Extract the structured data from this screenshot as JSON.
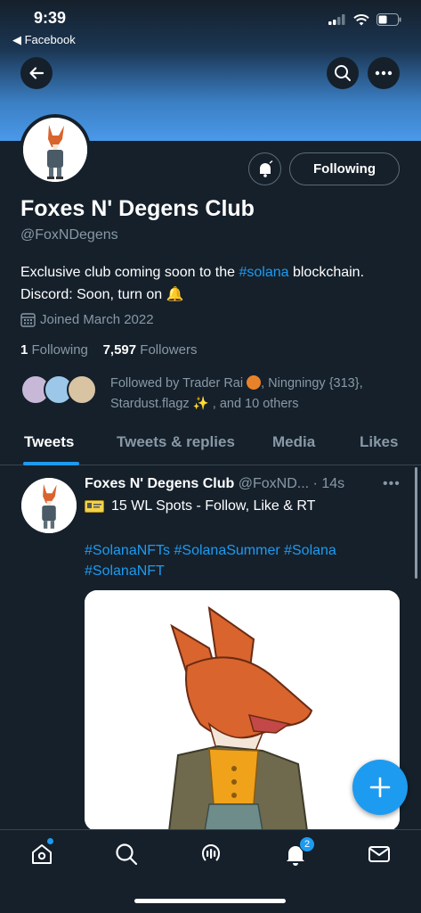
{
  "status_bar": {
    "time": "9:39",
    "back_app": "◀ Facebook"
  },
  "profile": {
    "name": "Foxes N' Degens Club",
    "handle": "@FoxNDegens",
    "bio_prefix": "Exclusive club coming soon to the ",
    "bio_hashtag": "#solana",
    "bio_suffix": " blockchain. Discord: Soon, turn on 🔔",
    "joined": "Joined March 2022",
    "following_count": "1",
    "following_label": "Following",
    "followers_count": "7,597",
    "followers_label": "Followers",
    "followed_by_prefix": "Followed by Trader Rai ",
    "followed_by_suffix": ", Ningningy {313}, Stardust.flagz ✨ , and 10 others",
    "follow_button": "Following"
  },
  "tabs": [
    {
      "label": "Tweets"
    },
    {
      "label": "Tweets & replies"
    },
    {
      "label": "Media"
    },
    {
      "label": "Likes"
    }
  ],
  "tweet": {
    "author": "Foxes N' Degens Club",
    "handle_time": "@FoxND... · 14s",
    "text": "15 WL Spots - Follow, Like & RT",
    "hashtags": "#SolanaNFTs #SolanaSummer #Solana #SolanaNFT"
  },
  "nav": {
    "notification_badge": "2"
  },
  "colors": {
    "background": "#15202b",
    "accent": "#1d9bf0",
    "muted": "#8899a6",
    "fox_orange": "#d9642e"
  }
}
